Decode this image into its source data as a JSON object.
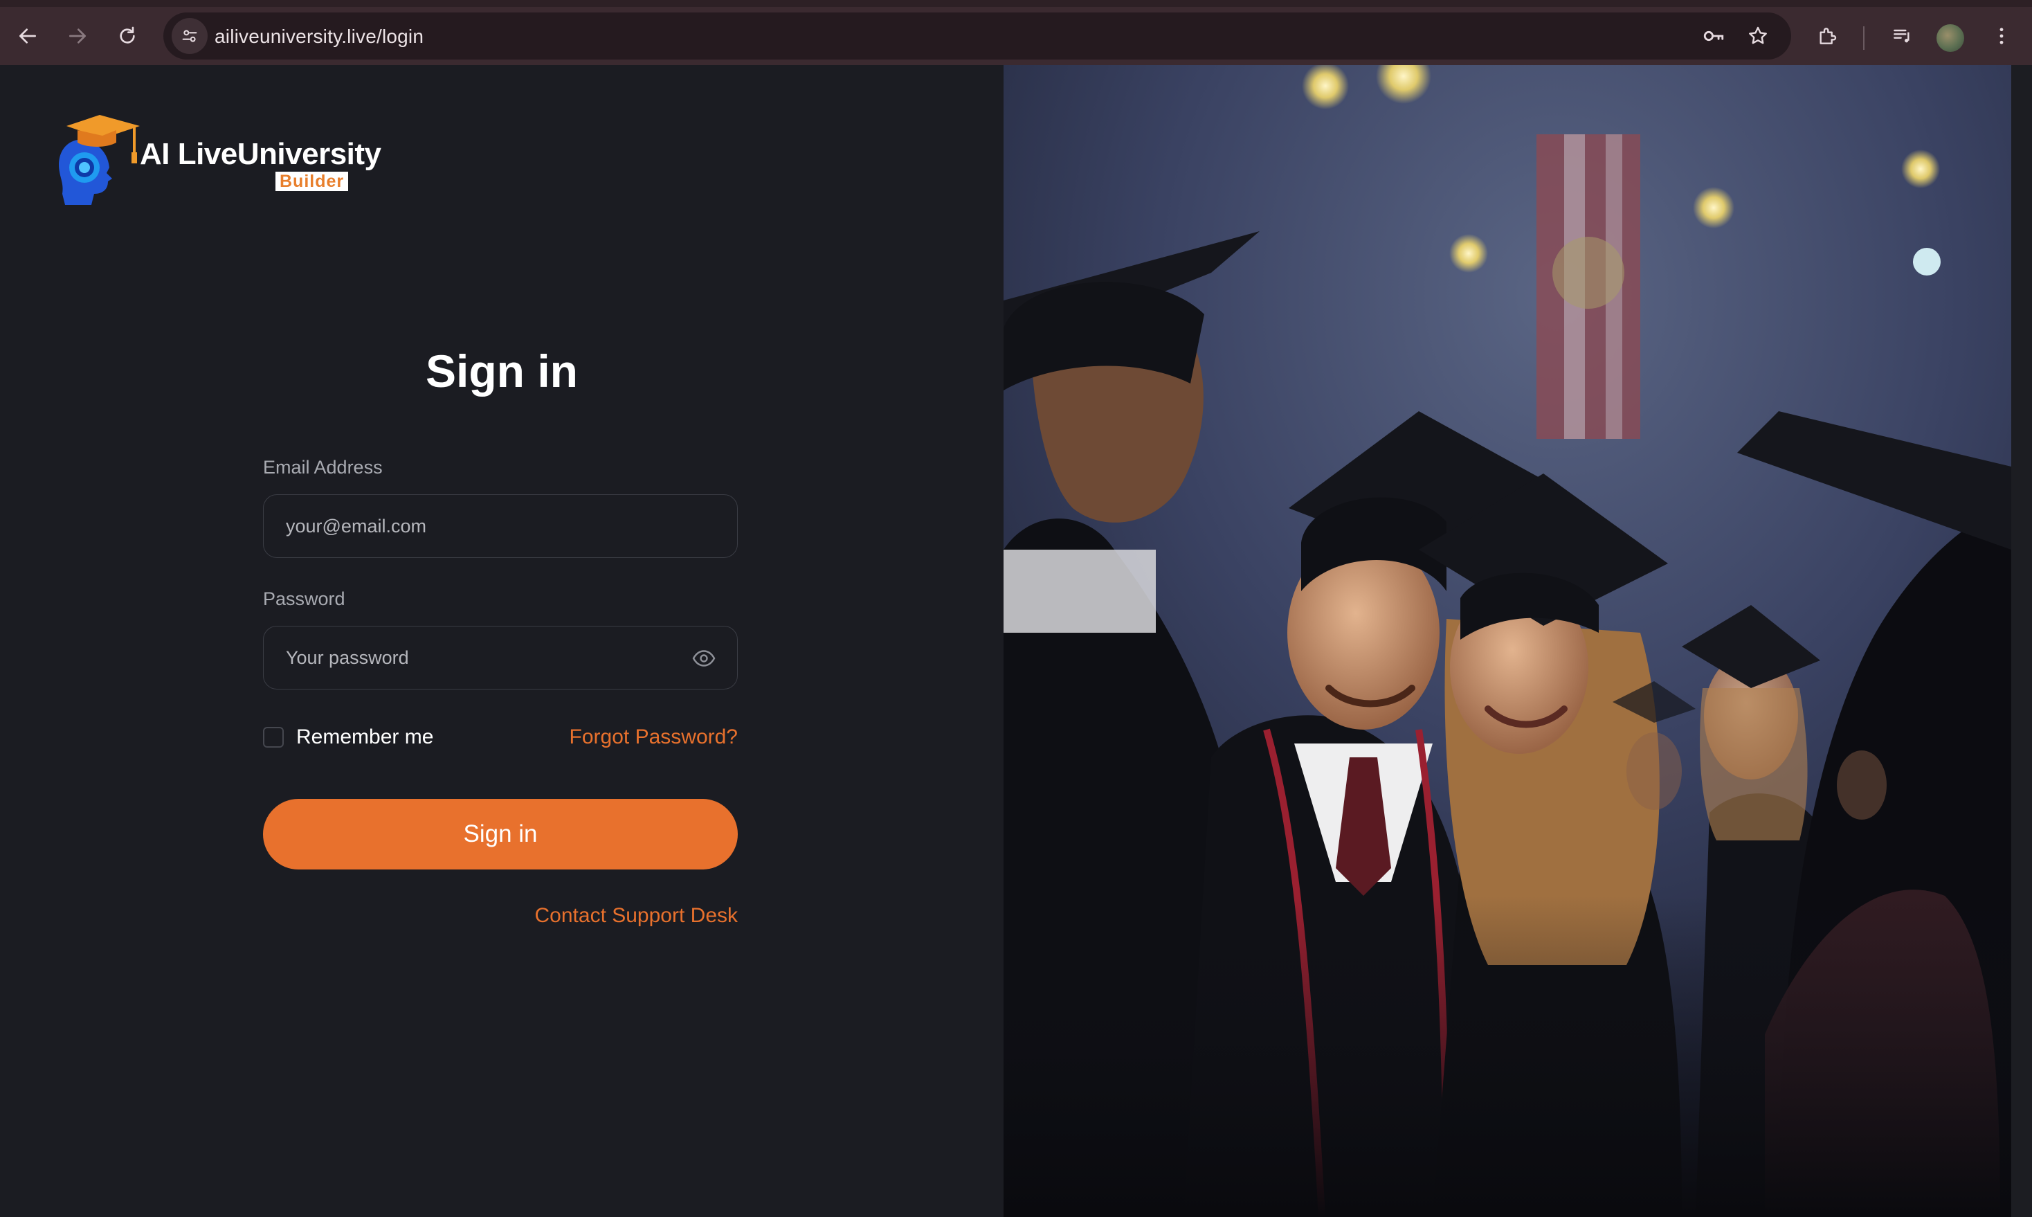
{
  "browser": {
    "url": "ailiveuniversity.live/login",
    "icons": [
      "back-arrow-icon",
      "forward-arrow-icon",
      "reload-icon",
      "site-settings-icon",
      "password-key-icon",
      "bookmark-star-icon",
      "extensions-icon",
      "media-controls-icon",
      "profile-avatar",
      "more-menu-icon"
    ]
  },
  "logo": {
    "name": "AI LiveUniversity",
    "tagline": "Builder"
  },
  "form": {
    "title": "Sign in",
    "email_label": "Email Address",
    "email_placeholder": "your@email.com",
    "password_label": "Password",
    "password_placeholder": "Your password",
    "remember_label": "Remember me",
    "forgot_link": "Forgot Password?",
    "submit_label": "Sign in",
    "support_link": "Contact Support Desk"
  },
  "colors": {
    "accent": "#e8712d",
    "background": "#1b1c22",
    "chrome": "#3b2a30"
  }
}
